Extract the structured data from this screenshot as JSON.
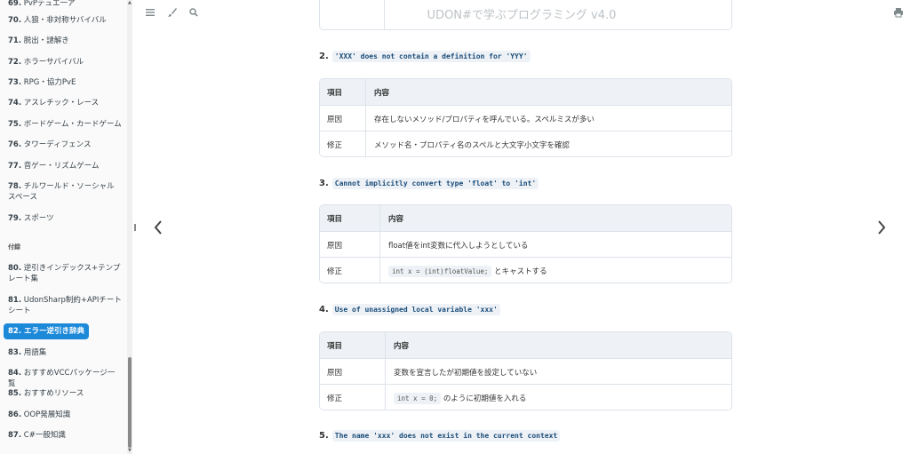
{
  "sidebar": {
    "items": [
      {
        "num": "69.",
        "label": "PvPデュエ一ア"
      },
      {
        "num": "70.",
        "label": "人狼・非対称サバイバル"
      },
      {
        "num": "71.",
        "label": "脱出・謎解き"
      },
      {
        "num": "72.",
        "label": "ホラーサバイバル"
      },
      {
        "num": "73.",
        "label": "RPG・協力PvE"
      },
      {
        "num": "74.",
        "label": "アスレチック・レース"
      },
      {
        "num": "75.",
        "label": "ボードゲーム・カードゲーム"
      },
      {
        "num": "76.",
        "label": "タワーディフェンス"
      },
      {
        "num": "77.",
        "label": "音ゲー・リズムゲーム"
      },
      {
        "num": "78.",
        "label": "チルワールド・ソーシャル",
        "label2": "スペース"
      },
      {
        "num": "79.",
        "label": "スポーツ"
      },
      {
        "num": "80.",
        "label": "逆引きインデックス+テンプ",
        "label2": "レート集"
      },
      {
        "num": "81.",
        "label": "UdonSharp制約+APIチート",
        "label2": "シート"
      },
      {
        "num": "82.",
        "label": "エラー逆引き辞典"
      },
      {
        "num": "83.",
        "label": "用語集"
      },
      {
        "num": "84.",
        "label": "おすすめVCCパッケージ一覧"
      },
      {
        "num": "85.",
        "label": "おすすめリソース"
      },
      {
        "num": "86.",
        "label": "OOP発展知識"
      },
      {
        "num": "87.",
        "label": "C#一般知識"
      }
    ],
    "section": "付録"
  },
  "header": {
    "title": "UDON#で学ぶプログラミング v4.0",
    "icons": [
      "menu-icon",
      "brush-icon",
      "search-icon",
      "print-icon"
    ]
  },
  "sections": [
    {
      "num": "2.",
      "code": "'XXX' does not contain a definition for 'YYY'",
      "col1": "項目",
      "col2": "内容",
      "r1a": "原因",
      "r1b": "存在しないメソッド/プロパティを呼んでいる。スペルミスが多い",
      "r2a": "修正",
      "r2b": "メソッド名・プロパティ名のスペルと大文字小文字を確認"
    },
    {
      "num": "3.",
      "code": "Cannot implicitly convert type 'float' to 'int'",
      "col1": "項目",
      "col2": "内容",
      "r1a": "原因",
      "r1b": "float値をint変数に代入しようとしている",
      "r2a": "修正",
      "r2code": "int x = (int)floatValue;",
      "r2b": "とキャストする"
    },
    {
      "num": "4.",
      "code": "Use of unassigned local variable 'xxx'",
      "col1": "項目",
      "col2": "内容",
      "r1a": "原因",
      "r1b": "変数を宣言したが初期値を設定していない",
      "r2a": "修正",
      "r2code": "int x = 0;",
      "r2b": "のように初期値を入れる"
    },
    {
      "num": "5.",
      "code": "The name 'xxx' does not exist in the current context"
    }
  ]
}
